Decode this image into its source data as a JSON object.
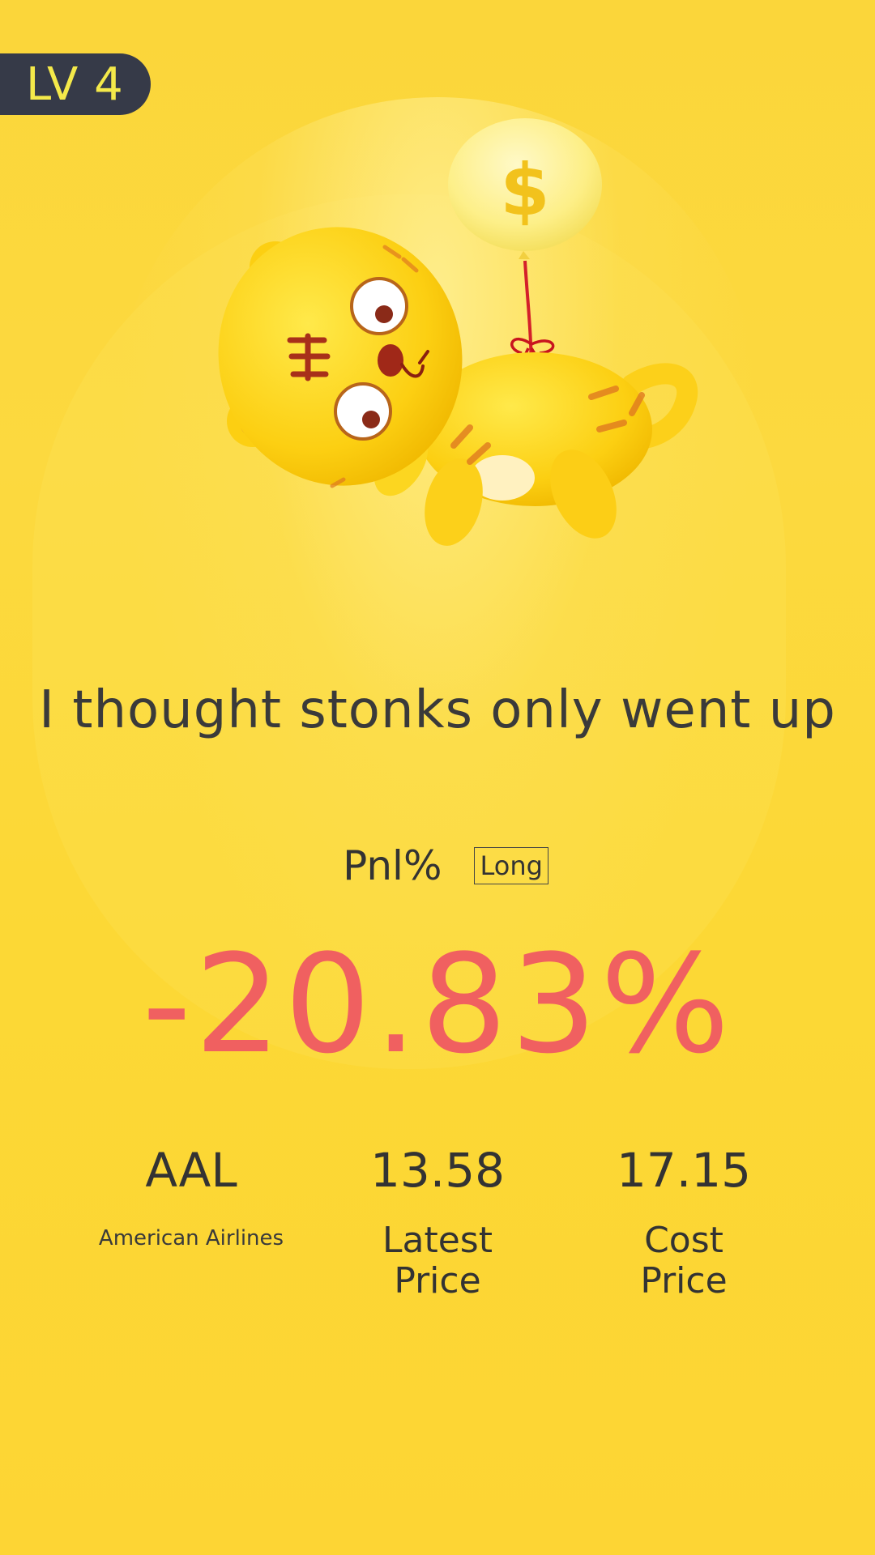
{
  "badge": {
    "level": "LV 4"
  },
  "mascot": {
    "name": "tiger-mascot",
    "balloon_symbol": "$"
  },
  "headline": "I thought stonks only went up",
  "pnl": {
    "label": "Pnl%",
    "direction": "Long",
    "value": "-20.83%"
  },
  "stats": {
    "ticker": {
      "value": "AAL",
      "label": "American Airlines"
    },
    "latest": {
      "value": "13.58",
      "label_line1": "Latest",
      "label_line2": "Price"
    },
    "cost": {
      "value": "17.15",
      "label_line1": "Cost",
      "label_line2": "Price"
    }
  },
  "colors": {
    "background": "#fcd93f",
    "badge_bg": "#363a48",
    "badge_text": "#f4e94a",
    "negative": "#f06060",
    "text": "#333333"
  }
}
